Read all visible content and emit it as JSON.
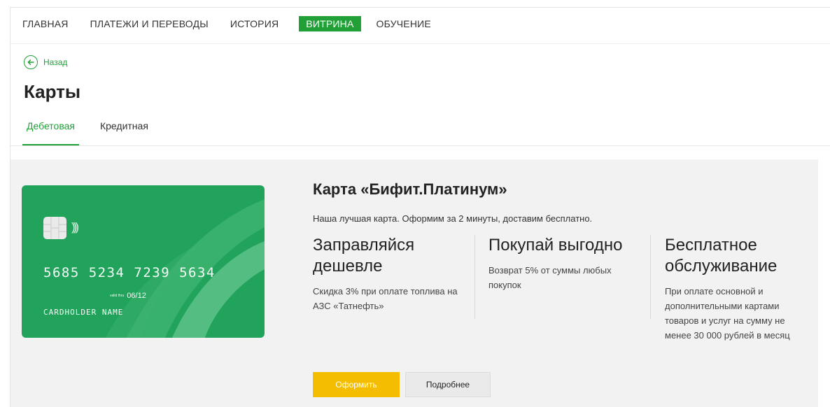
{
  "topnav": {
    "items": [
      "Главная",
      "Платежи и переводы",
      "История",
      "Витрина",
      "Обучение"
    ],
    "active_index": 3
  },
  "back": {
    "label": "Назад",
    "icon": "arrow-left-circle-icon"
  },
  "page": {
    "title": "Карты"
  },
  "tabs": {
    "items": [
      "Дебетовая",
      "Кредитная"
    ],
    "active_index": 0
  },
  "card": {
    "number": "5685 5234 7239 5634",
    "valid_thru_label": "valid thru",
    "expiry": "06/12",
    "holder": "CARDHOLDER NAME",
    "color": "#21a35b"
  },
  "product": {
    "title": "Карта «Бифит.Платинум»",
    "description": "Наша лучшая карта. Оформим за 2 минуты, доставим бесплатно."
  },
  "features": [
    {
      "head": "Заправляйся дешевле",
      "text": "Скидка 3% при оплате топлива на АЗС «Татнефть»"
    },
    {
      "head": "Покупай выгодно",
      "text": "Возврат 5% от суммы любых покупок"
    },
    {
      "head": "Бесплатное обслуживание",
      "text": "При оплате основной и дополнительными картами товаров и услуг на сумму не менее 30 000 рублей в месяц"
    }
  ],
  "actions": {
    "apply_label": "Оформить",
    "details_label": "Подробнее"
  },
  "colors": {
    "accent": "#21a038",
    "primary_button": "#f5bd00",
    "panel": "#f2f2f2"
  }
}
